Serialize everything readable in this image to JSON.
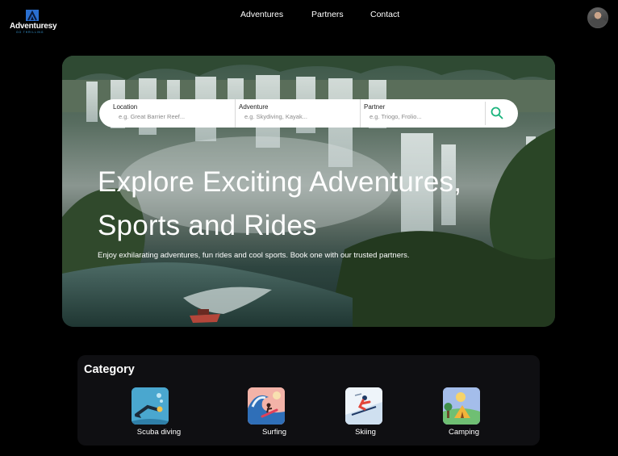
{
  "brand": {
    "name": "Adventuresy",
    "tagline": "GO THRILLING"
  },
  "nav": {
    "items": [
      "Adventures",
      "Partners",
      "Contact"
    ]
  },
  "search": {
    "location": {
      "label": "Location",
      "placeholder": "e.g. Great Barrier Reef..."
    },
    "adventure": {
      "label": "Adventure",
      "placeholder": "e.g. Skydiving, Kayak..."
    },
    "partner": {
      "label": "Partner",
      "placeholder": "e.g. Triogo, Frolio..."
    },
    "icon": "search-icon"
  },
  "hero": {
    "title": "Explore Exciting Adventures, Sports and Rides",
    "subtitle": "Enjoy exhilarating adventures, fun rides and cool sports. Book one with our trusted partners."
  },
  "category": {
    "title": "Category",
    "items": [
      {
        "label": "Scuba diving",
        "icon": "scuba-diving-icon"
      },
      {
        "label": "Surfing",
        "icon": "surfing-icon"
      },
      {
        "label": "Skiing",
        "icon": "skiing-icon"
      },
      {
        "label": "Camping",
        "icon": "camping-icon"
      }
    ]
  },
  "colors": {
    "accent": "#19b37c",
    "brand_blue": "#3aa0e0",
    "background": "#000000"
  }
}
